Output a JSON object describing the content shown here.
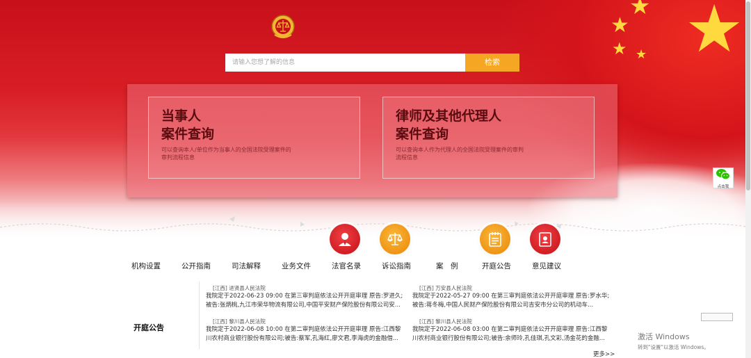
{
  "colors": {
    "brand_red": "#d81d25",
    "accent_orange": "#f5a623",
    "gold": "#ffd93d"
  },
  "emblem": {
    "icon": "court-emblem-icon"
  },
  "search": {
    "placeholder": "请输入您想了解的信息",
    "button_label": "检索"
  },
  "query_cards": [
    {
      "title": "当事人\n案件查询",
      "description": "可以查询本人/单位作为当事人的全国法院受理案件的审判流程信息"
    },
    {
      "title": "律师及其他代理人\n案件查询",
      "description": "可以查询本人作为代理人的全国法院受理案件的审判流程信息"
    }
  ],
  "nav": {
    "items": [
      {
        "label": "机构设置"
      },
      {
        "label": "公开指南"
      },
      {
        "label": "司法解释"
      },
      {
        "label": "业务文件"
      },
      {
        "label": "法官名录",
        "icon": "judge-person-icon",
        "color": "red"
      },
      {
        "label": "诉讼指南",
        "icon": "scales-icon",
        "color": "orange"
      },
      {
        "label": "案　例"
      },
      {
        "label": "开庭公告",
        "icon": "notepad-icon",
        "color": "orange"
      },
      {
        "label": "意见建议",
        "icon": "book-icon",
        "color": "red"
      }
    ]
  },
  "announcements": {
    "title": "开庭公告",
    "more_label": "更多>>",
    "items": [
      {
        "court": "[江西] 进贤县人民法院",
        "text": "我院定于2022-06-23 09:00 在第三审判庭依法公开开庭审理 原告:罗进久;被告:张炳桃,九江市荣华物流有限公司,中国平安财产保险股份有限公司安..."
      },
      {
        "court": "[江西] 万安县人民法院",
        "text": "我院定于2022-05-27 09:00 在第三审判庭依法公开开庭审理 原告:罗水华;被告:蒋冬梅,中国人民财产保险股份有限公司吉安市分公司的机动车..."
      },
      {
        "court": "[江西] 黎川县人民法院",
        "text": "我院定于2022-06-08 10:00 在第二审判庭依法公开开庭审理 原告:江西黎川农村商业银行股份有限公司;被告:蔡军,孔海红,廖文君,李海虎的金融借..."
      },
      {
        "court": "[江西] 黎川县人民法院",
        "text": "我院定于2022-06-08 03:00 在第二审判庭依法公开开庭审理 原告:江西黎川农村商业银行股份有限公司;被告:余师玲,孔佳琪,孔文彩,汤金花的金融..."
      }
    ]
  },
  "side_widget": {
    "icon": "wechat-icon",
    "label": "点击我"
  },
  "os_watermark": {
    "line1": "激活 Windows",
    "line2": "转到\"设置\"以激活 Windows。"
  }
}
